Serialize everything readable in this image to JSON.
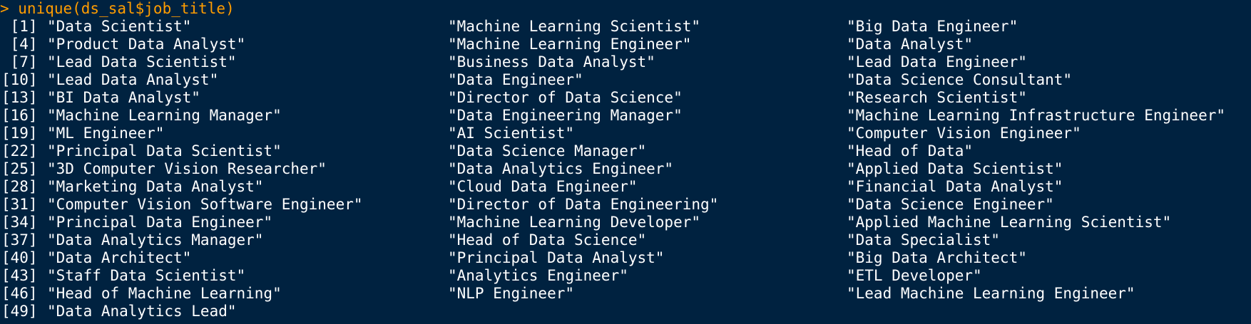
{
  "console": {
    "command_line": "> unique(ds_sal$job_title)",
    "prompt_color": "#ff9d00",
    "text_color": "#ffffff",
    "background": "#002240",
    "rows": [
      {
        "index": " [1]",
        "cells": [
          "\"Data Scientist\"",
          "\"Machine Learning Scientist\"",
          "\"Big Data Engineer\""
        ]
      },
      {
        "index": " [4]",
        "cells": [
          "\"Product Data Analyst\"",
          "\"Machine Learning Engineer\"",
          "\"Data Analyst\""
        ]
      },
      {
        "index": " [7]",
        "cells": [
          "\"Lead Data Scientist\"",
          "\"Business Data Analyst\"",
          "\"Lead Data Engineer\""
        ]
      },
      {
        "index": "[10]",
        "cells": [
          "\"Lead Data Analyst\"",
          "\"Data Engineer\"",
          "\"Data Science Consultant\""
        ]
      },
      {
        "index": "[13]",
        "cells": [
          "\"BI Data Analyst\"",
          "\"Director of Data Science\"",
          "\"Research Scientist\""
        ]
      },
      {
        "index": "[16]",
        "cells": [
          "\"Machine Learning Manager\"",
          "\"Data Engineering Manager\"",
          "\"Machine Learning Infrastructure Engineer\""
        ]
      },
      {
        "index": "[19]",
        "cells": [
          "\"ML Engineer\"",
          "\"AI Scientist\"",
          "\"Computer Vision Engineer\""
        ]
      },
      {
        "index": "[22]",
        "cells": [
          "\"Principal Data Scientist\"",
          "\"Data Science Manager\"",
          "\"Head of Data\""
        ]
      },
      {
        "index": "[25]",
        "cells": [
          "\"3D Computer Vision Researcher\"",
          "\"Data Analytics Engineer\"",
          "\"Applied Data Scientist\""
        ]
      },
      {
        "index": "[28]",
        "cells": [
          "\"Marketing Data Analyst\"",
          "\"Cloud Data Engineer\"",
          "\"Financial Data Analyst\""
        ]
      },
      {
        "index": "[31]",
        "cells": [
          "\"Computer Vision Software Engineer\"",
          "\"Director of Data Engineering\"",
          "\"Data Science Engineer\""
        ]
      },
      {
        "index": "[34]",
        "cells": [
          "\"Principal Data Engineer\"",
          "\"Machine Learning Developer\"",
          "\"Applied Machine Learning Scientist\""
        ]
      },
      {
        "index": "[37]",
        "cells": [
          "\"Data Analytics Manager\"",
          "\"Head of Data Science\"",
          "\"Data Specialist\""
        ]
      },
      {
        "index": "[40]",
        "cells": [
          "\"Data Architect\"",
          "\"Principal Data Analyst\"",
          "\"Big Data Architect\""
        ]
      },
      {
        "index": "[43]",
        "cells": [
          "\"Staff Data Scientist\"",
          "\"Analytics Engineer\"",
          "\"ETL Developer\""
        ]
      },
      {
        "index": "[46]",
        "cells": [
          "\"Head of Machine Learning\"",
          "\"NLP Engineer\"",
          "\"Lead Machine Learning Engineer\""
        ]
      },
      {
        "index": "[49]",
        "cells": [
          "\"Data Analytics Lead\"",
          "",
          ""
        ]
      }
    ]
  }
}
